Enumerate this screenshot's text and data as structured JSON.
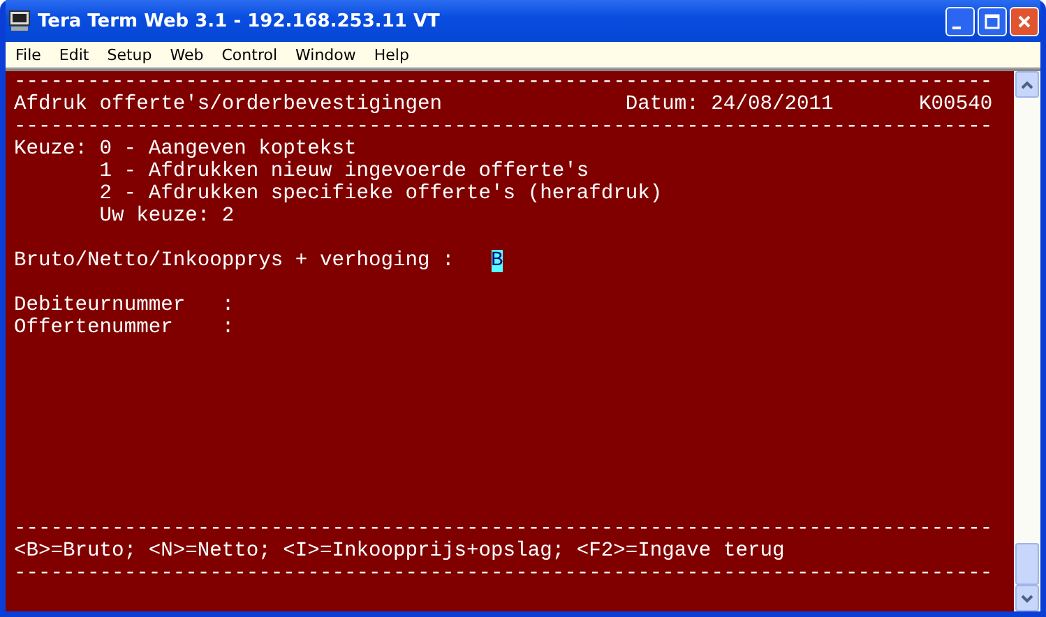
{
  "window": {
    "title": "Tera Term Web 3.1 - 192.168.253.11 VT"
  },
  "menu": [
    "File",
    "Edit",
    "Setup",
    "Web",
    "Control",
    "Window",
    "Help"
  ],
  "terminal": {
    "rows": [
      {
        "kind": "rule",
        "text": "--------------------------------------------------------------------------------"
      },
      {
        "kind": "header",
        "title": "Afdruk offerte's/orderbevestigingen",
        "date": "Datum: 24/08/2011",
        "code": "K00540"
      },
      {
        "kind": "rule",
        "text": "--------------------------------------------------------------------------------"
      },
      {
        "kind": "menu",
        "label": "Keuze:",
        "options": [
          "0 - Aangeven koptekst",
          "1 - Afdrukken nieuw ingevoerde offerte's",
          "2 - Afdrukken specifieke offerte's (herafdruk)"
        ],
        "prompt": "Uw keuze: 2"
      },
      {
        "kind": "blank"
      },
      {
        "kind": "input",
        "label": "Bruto/Netto/Inkoopprys + verhoging :",
        "value": "B"
      },
      {
        "kind": "blank"
      },
      {
        "kind": "field",
        "label": "Debiteurnummer",
        "colon": ":"
      },
      {
        "kind": "field",
        "label": "Offertenummer",
        "colon": ":"
      }
    ],
    "footer": {
      "rule_top": "--------------------------------------------------------------------------------",
      "help": "<B>=Bruto; <N>=Netto; <I>=Inkoopprijs+opslag; <F2>=Ingave terug",
      "rule_bottom": "--------------------------------------------------------------------------------"
    }
  }
}
